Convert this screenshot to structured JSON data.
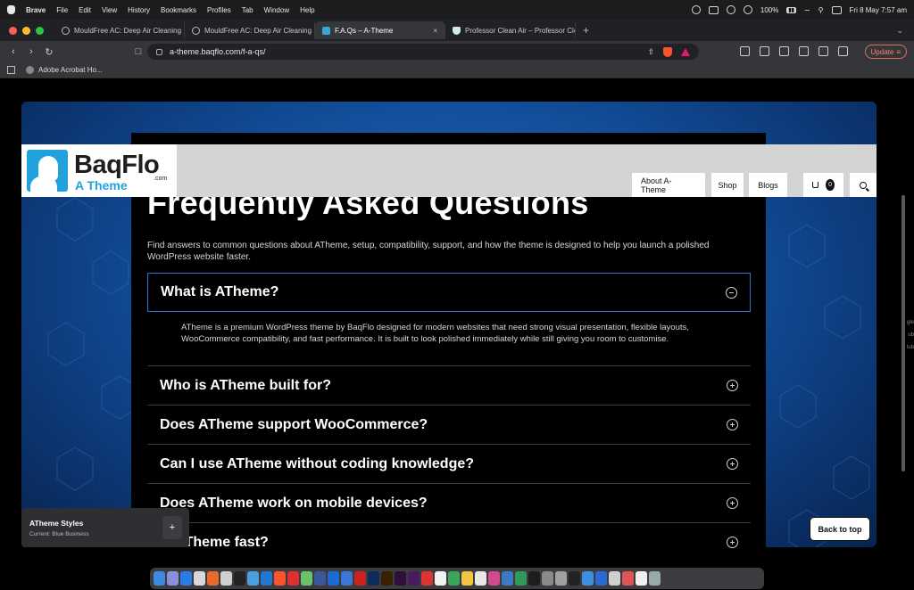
{
  "menubar": {
    "app_name": "Brave",
    "items": [
      "File",
      "Edit",
      "View",
      "History",
      "Bookmarks",
      "Profiles",
      "Tab",
      "Window",
      "Help"
    ],
    "battery": "100%",
    "datetime": "Fri 8 May  7:57 am"
  },
  "tabs": [
    {
      "title": "MouldFree AC: Deep Air Cleaning",
      "active": false
    },
    {
      "title": "MouldFree AC: Deep Air Cleaning",
      "active": false
    },
    {
      "title": "F.A.Qs – A-Theme",
      "active": true
    },
    {
      "title": "Professor Clean Air – Professor Cle",
      "active": false
    }
  ],
  "address_bar": {
    "url": "a-theme.baqflo.com/f-a-qs/",
    "update_label": "Update"
  },
  "bookmarks": [
    {
      "label": "Adobe Acrobat Ho..."
    }
  ],
  "site": {
    "logo_text": "BaqFlo",
    "logo_sub": "A Theme",
    "logo_com": ".com",
    "nav": [
      "About A-Theme",
      "Shop",
      "Blogs"
    ],
    "cart_count": "0"
  },
  "page": {
    "title": "Frequently Asked Questions",
    "intro": "Find answers to common questions about ATheme, setup, compatibility, support, and how the theme is designed to help you launch a polished WordPress website faster."
  },
  "faqs": [
    {
      "question": "What is ATheme?",
      "open": true,
      "answer": "ATheme is a premium WordPress theme by BaqFlo designed for modern websites that need strong visual presentation, flexible layouts, WooCommerce compatibility, and fast performance. It is built to look polished immediately while still giving you room to customise."
    },
    {
      "question": "Who is ATheme built for?",
      "open": false
    },
    {
      "question": "Does ATheme support WooCommerce?",
      "open": false
    },
    {
      "question": "Can I use ATheme without coding knowledge?",
      "open": false
    },
    {
      "question": "Does ATheme work on mobile devices?",
      "open": false
    },
    {
      "question": "Is ATheme fast?",
      "open": false
    }
  ],
  "styles_panel": {
    "title": "ATheme Styles",
    "subtitle": "Current: Blue Business",
    "add_label": "+"
  },
  "back_to_top": "Back to top",
  "edge_fragments": [
    "gle",
    "ub",
    "lub"
  ],
  "colors": {
    "accent_blue": "#22a2dc",
    "hero_blue": "#1557a8",
    "open_border": "#2c6fd1",
    "update_orange": "#e0704d"
  }
}
